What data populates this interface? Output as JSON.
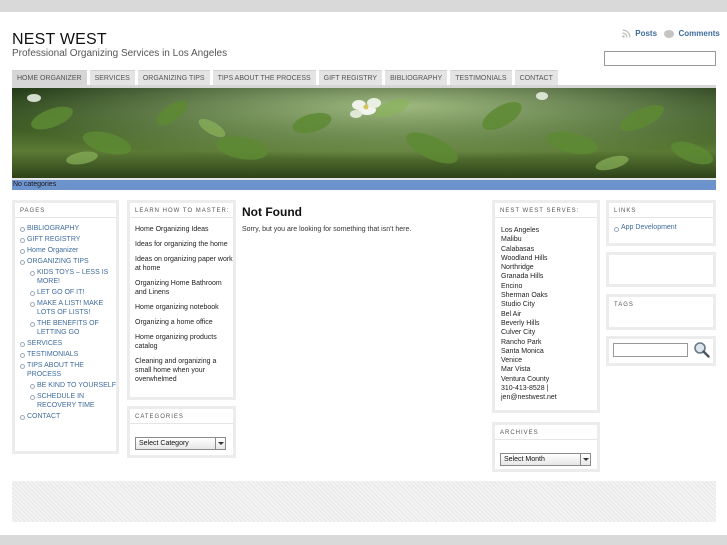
{
  "site": {
    "title": "NEST WEST",
    "description": "Professional Organizing Services in Los Angeles"
  },
  "feeds": {
    "posts": "Posts",
    "comments": "Comments"
  },
  "nav": {
    "items": [
      "HOME ORGANIZER",
      "SERVICES",
      "ORGANIZING TIPS",
      "TIPS ABOUT THE PROCESS",
      "GIFT REGISTRY",
      "BIBLIOGRAPHY",
      "TESTIMONIALS",
      "CONTACT"
    ]
  },
  "category_bar": {
    "text": "No categories"
  },
  "pages_widget": {
    "title": "PAGES",
    "items": [
      {
        "label": "BIBLIOGRAPHY",
        "sub": false
      },
      {
        "label": "GIFT REGISTRY",
        "sub": false
      },
      {
        "label": "Home Organizer",
        "sub": false
      },
      {
        "label": "ORGANIZING TIPS",
        "sub": false
      },
      {
        "label": "KIDS TOYS – LESS IS MORE!",
        "sub": true
      },
      {
        "label": "LET GO OF IT!",
        "sub": true
      },
      {
        "label": "MAKE A LIST! MAKE LOTS OF LISTS!",
        "sub": true
      },
      {
        "label": "THE BENEFITS OF LETTING GO",
        "sub": true
      },
      {
        "label": "SERVICES",
        "sub": false
      },
      {
        "label": "TESTIMONIALS",
        "sub": false
      },
      {
        "label": "TIPS ABOUT THE PROCESS",
        "sub": false
      },
      {
        "label": "BE KIND TO YOURSELF",
        "sub": true
      },
      {
        "label": "SCHEDULE IN RECOVERY TIME",
        "sub": true
      },
      {
        "label": "CONTACT",
        "sub": false
      }
    ]
  },
  "learn_widget": {
    "title": "LEARN HOW TO MASTER:",
    "items": [
      "Home Organizing Ideas",
      "Ideas for organizing the home",
      "Ideas on organizing paper work at home",
      "Organizing Home Bathroom and Linens",
      "Home organizing notebook",
      "Organizing a home office",
      "Home organizing products catalog",
      "Cleaning and organizing a small home when your overwhelmed"
    ]
  },
  "categories_widget": {
    "title": "CATEGORIES",
    "select": "Select Category"
  },
  "main": {
    "title": "Not Found",
    "text": "Sorry, but you are looking for something that isn't here."
  },
  "serves_widget": {
    "title": "NEST WEST SERVES:",
    "items": [
      "Los Angeles",
      "Malibu",
      "Calabasas",
      "Woodland Hills",
      "Northridge",
      "Granada Hills",
      "Encino",
      "Sherman Oaks",
      "Studio City",
      "Bel Air",
      "Beverly Hills",
      "Culver City",
      "Rancho Park",
      "Santa Monica",
      "Venice",
      "Mar Vista",
      "Ventura County",
      "310-413-8528 |",
      "jen@nestwest.net"
    ]
  },
  "archives_widget": {
    "title": "ARCHIVES",
    "select": "Select Month"
  },
  "links_widget": {
    "title": "LINKS",
    "items": [
      "App Development"
    ]
  },
  "tags_widget": {
    "title": "TAGS"
  },
  "icons": {
    "feed": "rss-icon",
    "comments": "speech-bubble-icon",
    "search": "magnifier-icon"
  },
  "colors": {
    "link": "#3f6c9d",
    "category_bar": "#6d93cd"
  }
}
